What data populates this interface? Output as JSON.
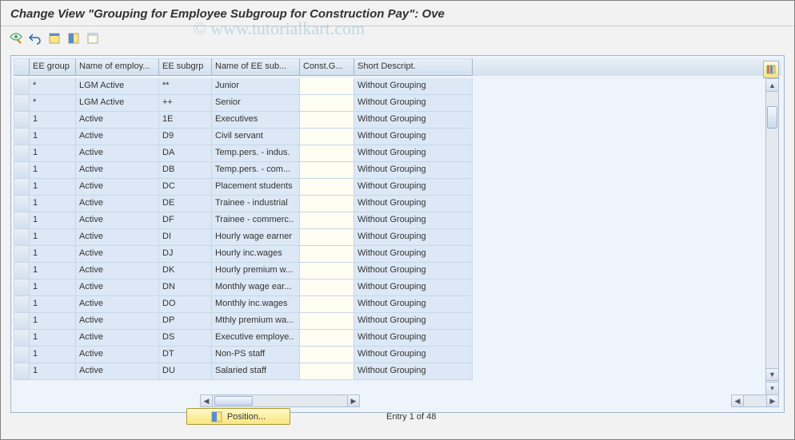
{
  "title": "Change View \"Grouping for Employee Subgroup for Construction Pay\": Ove",
  "watermark": "© www.tutorialkart.com",
  "toolbar": {
    "icons": [
      "glasses-pencil-icon",
      "undo-icon",
      "select-all-icon",
      "select-block-icon",
      "deselect-all-icon"
    ]
  },
  "table": {
    "headers": {
      "sel": "",
      "c1": "EE group",
      "c2": "Name of employ...",
      "c3": "EE subgrp",
      "c4": "Name of EE sub...",
      "c5": "Const.G...",
      "c6": "Short Descript."
    },
    "rows": [
      {
        "c1": "*",
        "c2": "LGM Active",
        "c3": "**",
        "c4": "Junior",
        "c5": "",
        "c6": "Without Grouping"
      },
      {
        "c1": "*",
        "c2": "LGM Active",
        "c3": "++",
        "c4": "Senior",
        "c5": "",
        "c6": "Without Grouping"
      },
      {
        "c1": "1",
        "c2": "Active",
        "c3": "1E",
        "c4": "Executives",
        "c5": "",
        "c6": "Without Grouping"
      },
      {
        "c1": "1",
        "c2": "Active",
        "c3": "D9",
        "c4": "Civil servant",
        "c5": "",
        "c6": "Without Grouping"
      },
      {
        "c1": "1",
        "c2": "Active",
        "c3": "DA",
        "c4": "Temp.pers. - indus.",
        "c5": "",
        "c6": "Without Grouping"
      },
      {
        "c1": "1",
        "c2": "Active",
        "c3": "DB",
        "c4": "Temp.pers. - com...",
        "c5": "",
        "c6": "Without Grouping"
      },
      {
        "c1": "1",
        "c2": "Active",
        "c3": "DC",
        "c4": "Placement students",
        "c5": "",
        "c6": "Without Grouping"
      },
      {
        "c1": "1",
        "c2": "Active",
        "c3": "DE",
        "c4": "Trainee - industrial",
        "c5": "",
        "c6": "Without Grouping"
      },
      {
        "c1": "1",
        "c2": "Active",
        "c3": "DF",
        "c4": "Trainee - commerc..",
        "c5": "",
        "c6": "Without Grouping"
      },
      {
        "c1": "1",
        "c2": "Active",
        "c3": "DI",
        "c4": "Hourly wage earner",
        "c5": "",
        "c6": "Without Grouping"
      },
      {
        "c1": "1",
        "c2": "Active",
        "c3": "DJ",
        "c4": "Hourly inc.wages",
        "c5": "",
        "c6": "Without Grouping"
      },
      {
        "c1": "1",
        "c2": "Active",
        "c3": "DK",
        "c4": "Hourly premium w...",
        "c5": "",
        "c6": "Without Grouping"
      },
      {
        "c1": "1",
        "c2": "Active",
        "c3": "DN",
        "c4": "Monthly wage ear...",
        "c5": "",
        "c6": "Without Grouping"
      },
      {
        "c1": "1",
        "c2": "Active",
        "c3": "DO",
        "c4": "Monthly inc.wages",
        "c5": "",
        "c6": "Without Grouping"
      },
      {
        "c1": "1",
        "c2": "Active",
        "c3": "DP",
        "c4": "Mthly premium wa...",
        "c5": "",
        "c6": "Without Grouping"
      },
      {
        "c1": "1",
        "c2": "Active",
        "c3": "DS",
        "c4": "Executive employe..",
        "c5": "",
        "c6": "Without Grouping"
      },
      {
        "c1": "1",
        "c2": "Active",
        "c3": "DT",
        "c4": "Non-PS staff",
        "c5": "",
        "c6": "Without Grouping"
      },
      {
        "c1": "1",
        "c2": "Active",
        "c3": "DU",
        "c4": "Salaried staff",
        "c5": "",
        "c6": "Without Grouping"
      }
    ]
  },
  "footer": {
    "position_label": "Position...",
    "entry_text": "Entry 1 of 48"
  }
}
